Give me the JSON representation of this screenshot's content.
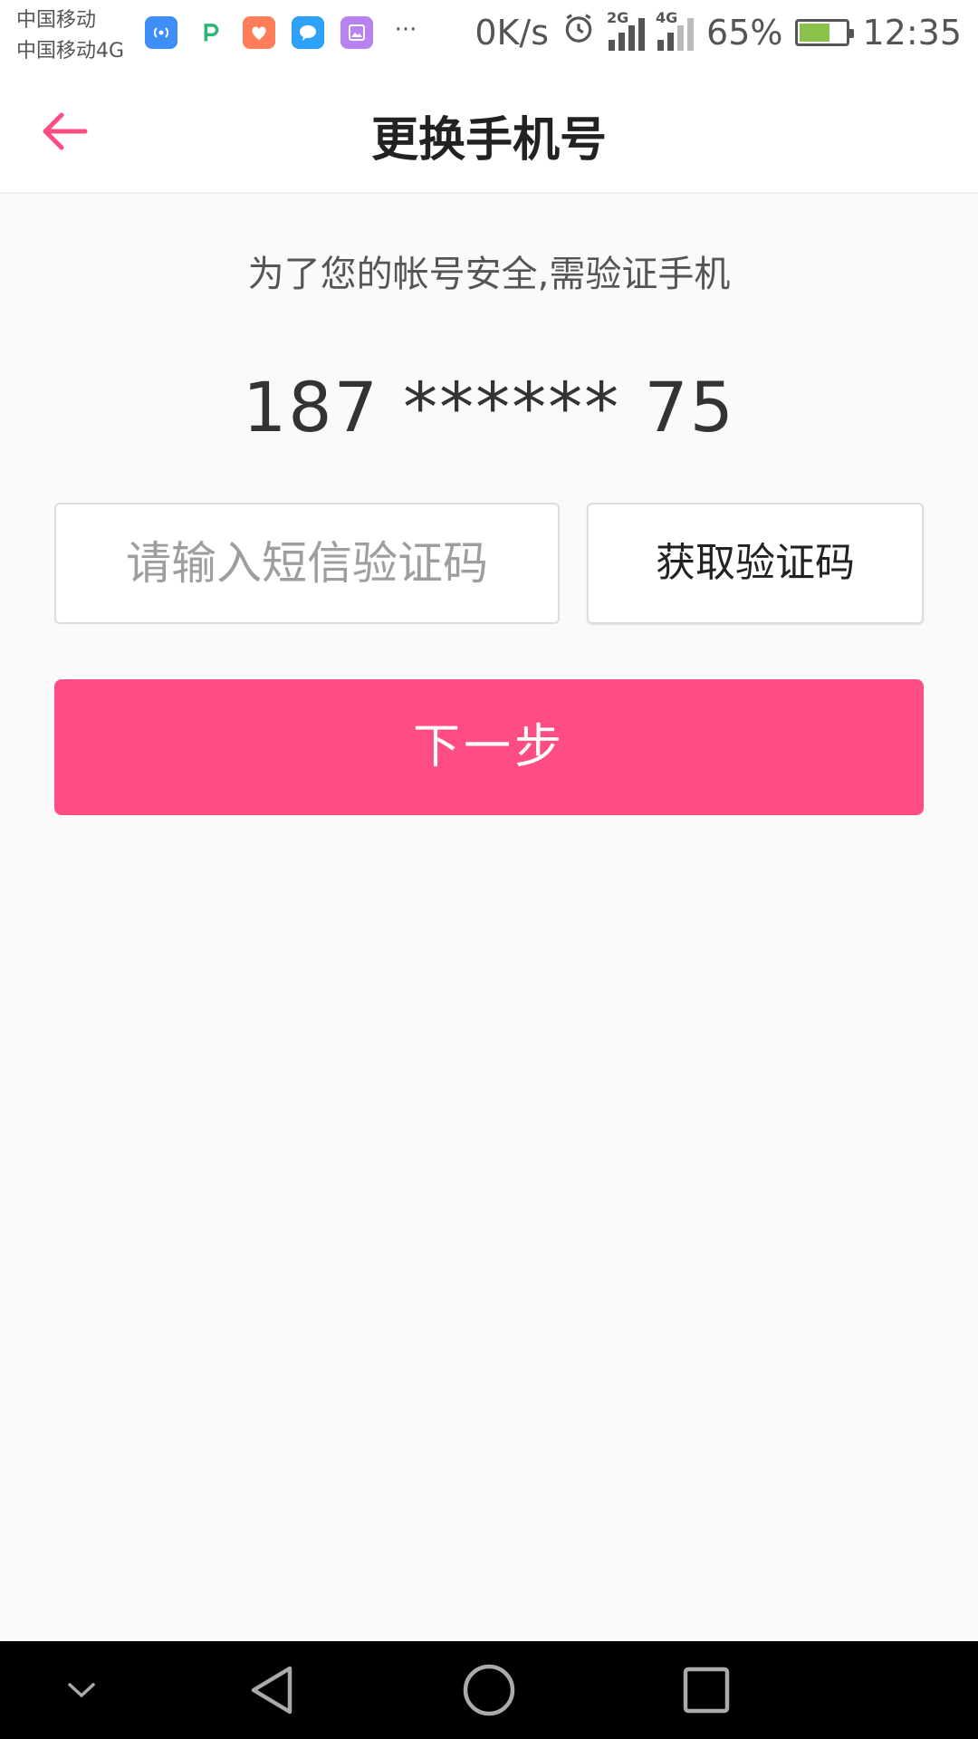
{
  "status_bar": {
    "carrier_1": "中国移动",
    "carrier_2": "中国移动4G",
    "net_speed": "0K/s",
    "sig1_label": "2G",
    "sig2_label": "4G",
    "battery": "65%",
    "time": "12:35",
    "notification_icons": [
      "wifi-hotspot-icon",
      "p-app-icon",
      "heart-app-icon",
      "message-app-icon",
      "gallery-app-icon"
    ],
    "more": "···"
  },
  "header": {
    "title": "更换手机号",
    "back_icon": "arrow-left-icon"
  },
  "main": {
    "hint": "为了您的帐号安全,需验证手机",
    "phone": "187 ****** 75",
    "code_placeholder": "请输入短信验证码",
    "get_code_label": "获取验证码",
    "next_label": "下一步"
  },
  "colors": {
    "accent": "#ff4c82",
    "title_text": "#222222",
    "hint_text": "#555555",
    "placeholder": "#9e9e9e"
  },
  "nav_bar": {
    "icons": [
      "chevron-down-icon",
      "back-triangle-icon",
      "home-circle-icon",
      "recents-square-icon"
    ]
  }
}
